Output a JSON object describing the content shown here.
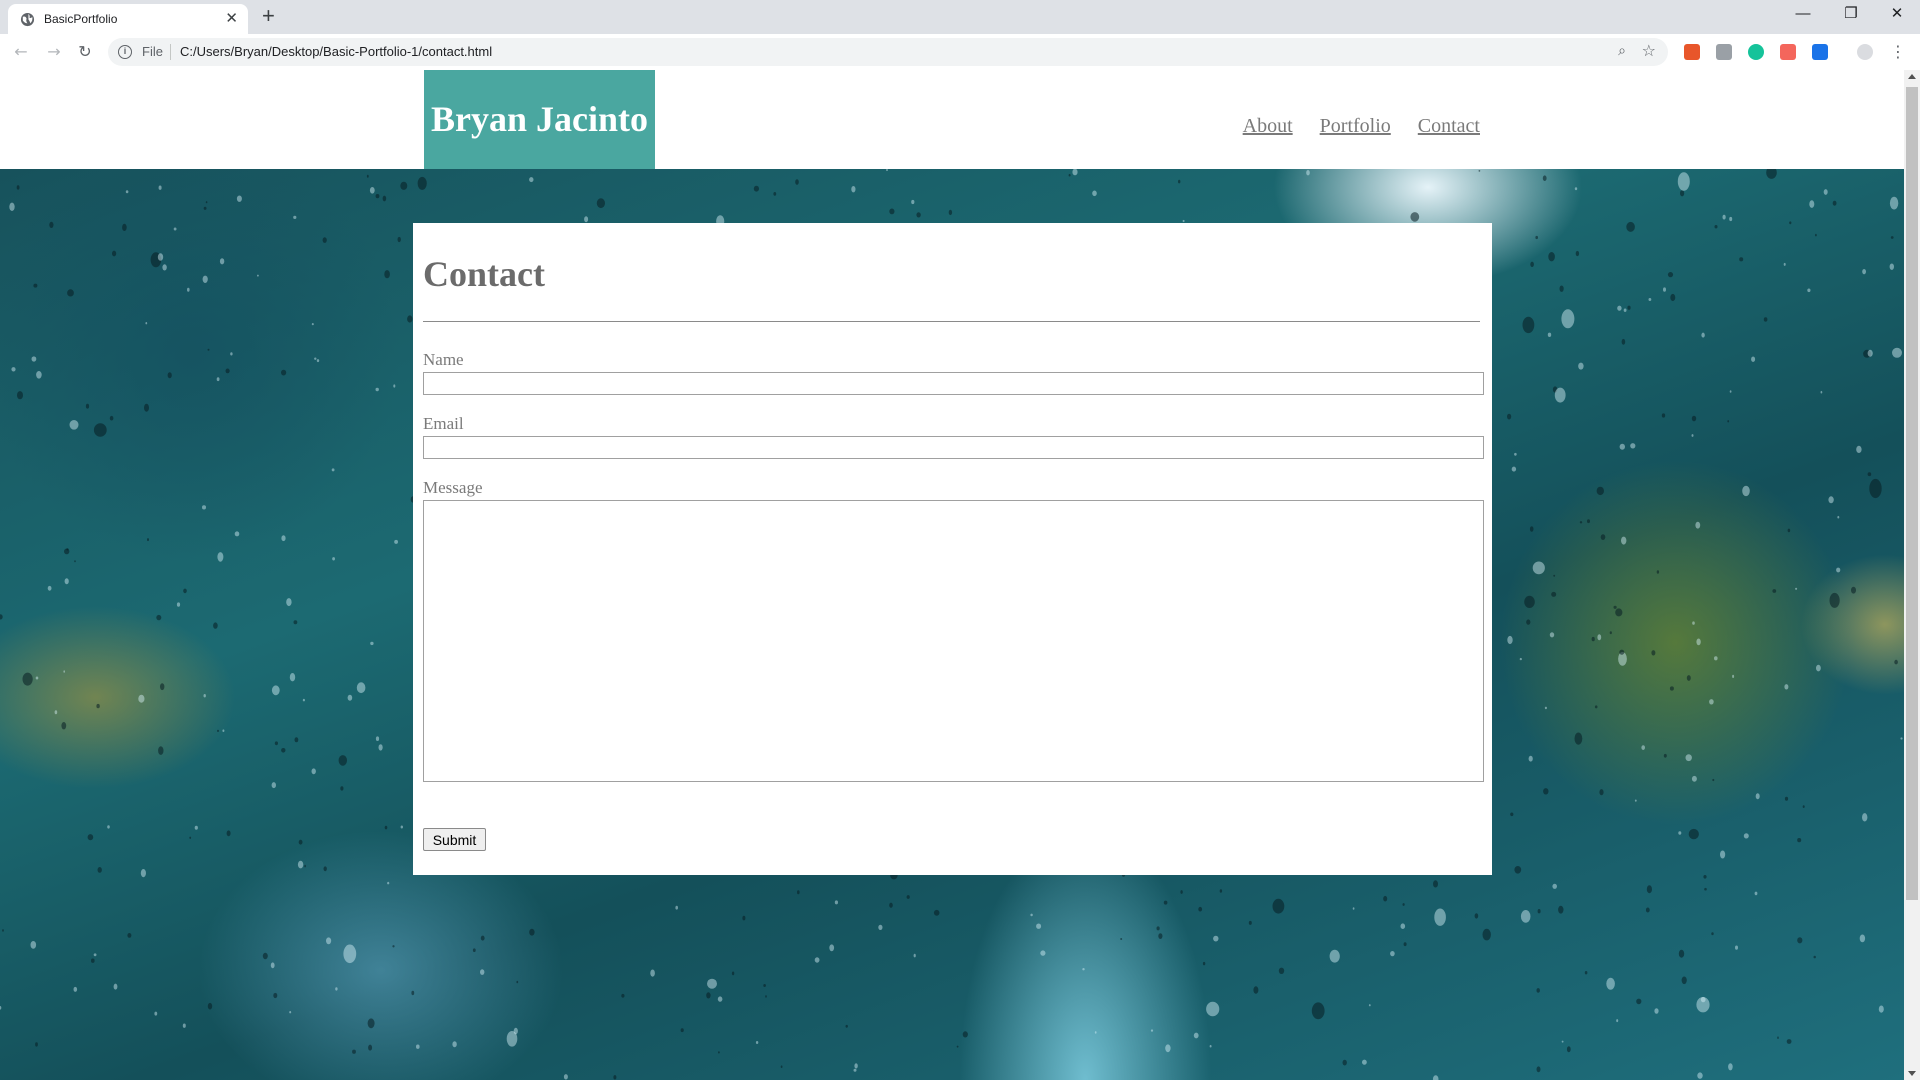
{
  "browser": {
    "tab_title": "BasicPortfolio",
    "tab_close": "✕",
    "new_tab": "+",
    "scheme": "File",
    "url": "C:/Users/Bryan/Desktop/Basic-Portfolio-1/contact.html",
    "window_controls": {
      "minimize": "—",
      "restore": "❐",
      "close": "✕"
    },
    "nav": {
      "back": "←",
      "forward": "→",
      "reload": "↻"
    },
    "extension_colors": [
      "#e8562a",
      "#9aa0a6",
      "#15c39a",
      "#f4665c",
      "#1a73e8",
      "#dadce0"
    ]
  },
  "site": {
    "brand": "Bryan Jacinto",
    "brand_color": "#4aa7a0",
    "nav": [
      {
        "label": "About"
      },
      {
        "label": "Portfolio"
      },
      {
        "label": "Contact"
      }
    ]
  },
  "contact": {
    "heading": "Contact",
    "name_label": "Name",
    "name_value": "",
    "email_label": "Email",
    "email_value": "",
    "message_label": "Message",
    "message_value": "",
    "submit_label": "Submit"
  }
}
